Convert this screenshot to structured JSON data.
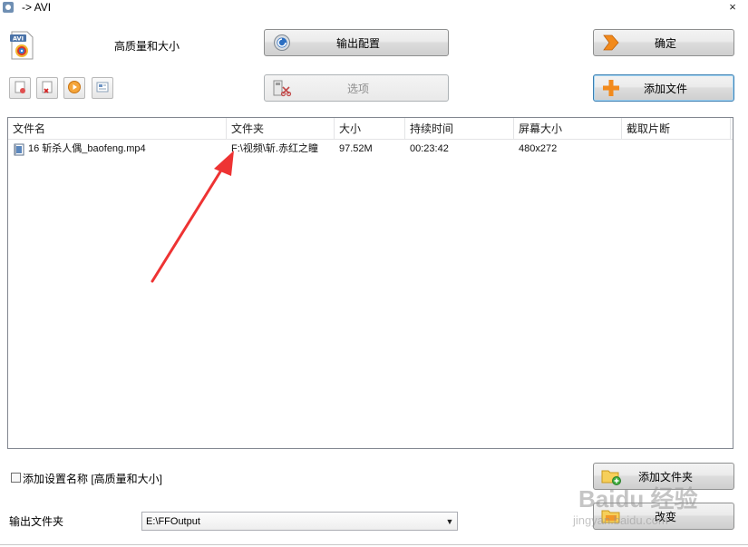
{
  "window": {
    "title": "-> AVI",
    "close_glyph": "×"
  },
  "header": {
    "profile_label": "高质量和大小"
  },
  "buttons": {
    "output_config": "输出配置",
    "confirm": "确定",
    "options": "选项",
    "add_file": "添加文件",
    "add_folder": "添加文件夹",
    "change": "改变"
  },
  "table": {
    "columns": [
      "文件名",
      "文件夹",
      "大小",
      "持续时间",
      "屏幕大小",
      "截取片断"
    ],
    "rows": [
      {
        "name": "16 斩杀人偶_baofeng.mp4",
        "folder": "F:\\视频\\斩.赤红之瞳",
        "size": "97.52M",
        "duration": "00:23:42",
        "screen": "480x272",
        "clip": ""
      }
    ]
  },
  "settings": {
    "add_setting_name_label": "添加设置名称 [高质量和大小]",
    "add_setting_name_checked": false,
    "output_folder_label": "输出文件夹",
    "output_folder_value": "E:\\FFOutput"
  },
  "watermark": {
    "brand": "Baidu 经验",
    "url": "jingyan.baidu.com"
  },
  "colors": {
    "arrow": "#ee3333",
    "accent_orange": "#f28a1c",
    "focus_border": "#3c7fb1"
  },
  "icons": [
    "avi-file-icon",
    "gear-icon",
    "confirm-arrow-icon",
    "options-icon",
    "plus-icon",
    "folder-add-icon",
    "folder-icon",
    "video-file-icon"
  ]
}
